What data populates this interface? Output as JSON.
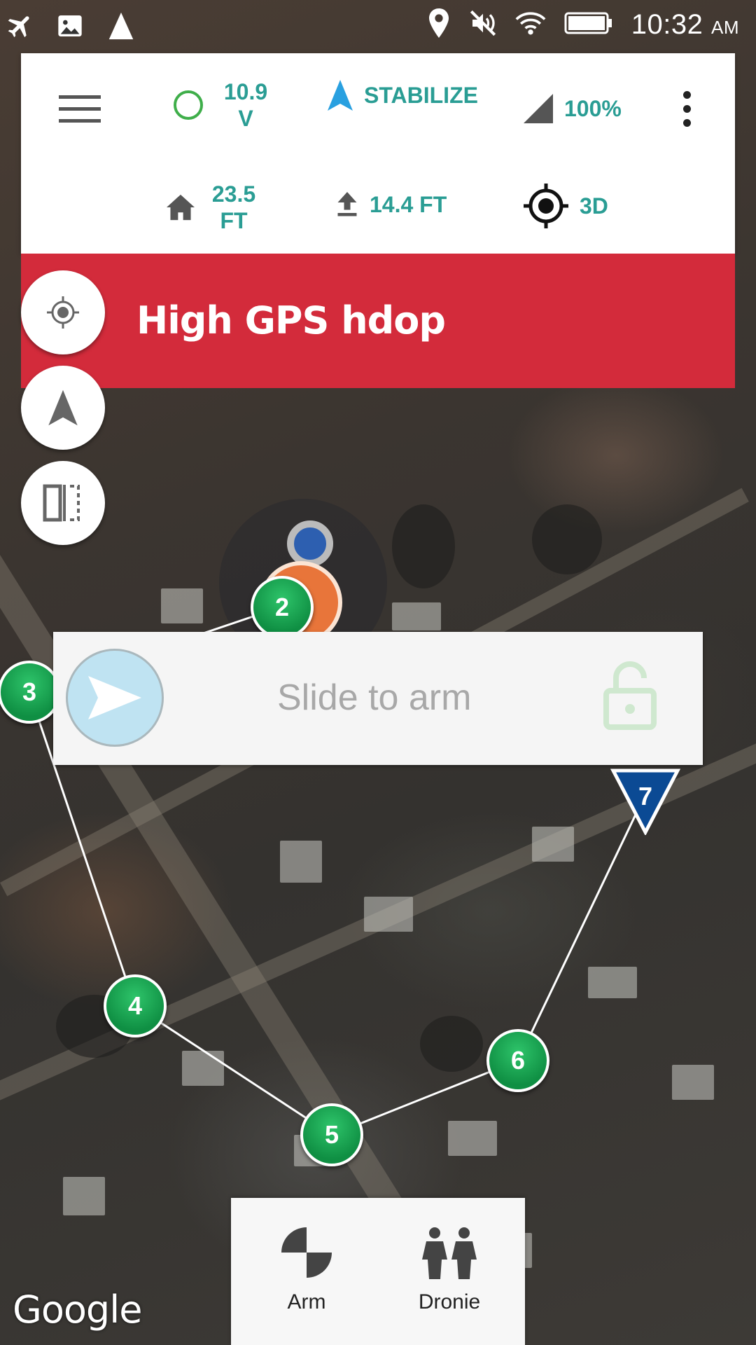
{
  "status_bar": {
    "icons": [
      "airplane-mode-icon",
      "image-notification-icon",
      "navigation-icon",
      "location-icon",
      "mute-icon",
      "wifi-icon",
      "battery-icon"
    ],
    "time": "10:32",
    "ampm": "AM"
  },
  "telemetry": {
    "battery_voltage": "10.9 V",
    "flight_mode": "STABILIZE",
    "signal": "100%",
    "home_distance": "23.5 FT",
    "altitude": "14.4 FT",
    "gps_fix": "3D"
  },
  "alert": {
    "message": "High GPS hdop"
  },
  "slider": {
    "label": "Slide to arm"
  },
  "waypoints": [
    "2",
    "3",
    "4",
    "5",
    "6",
    "7"
  ],
  "actions": {
    "arm_label": "Arm",
    "dronie_label": "Dronie"
  },
  "map": {
    "attribution": "Google"
  },
  "colors": {
    "accent": "#2a9d94",
    "alert": "#d32b3b",
    "waypoint": "#13a04f",
    "last_waypoint": "#0b4a94"
  }
}
